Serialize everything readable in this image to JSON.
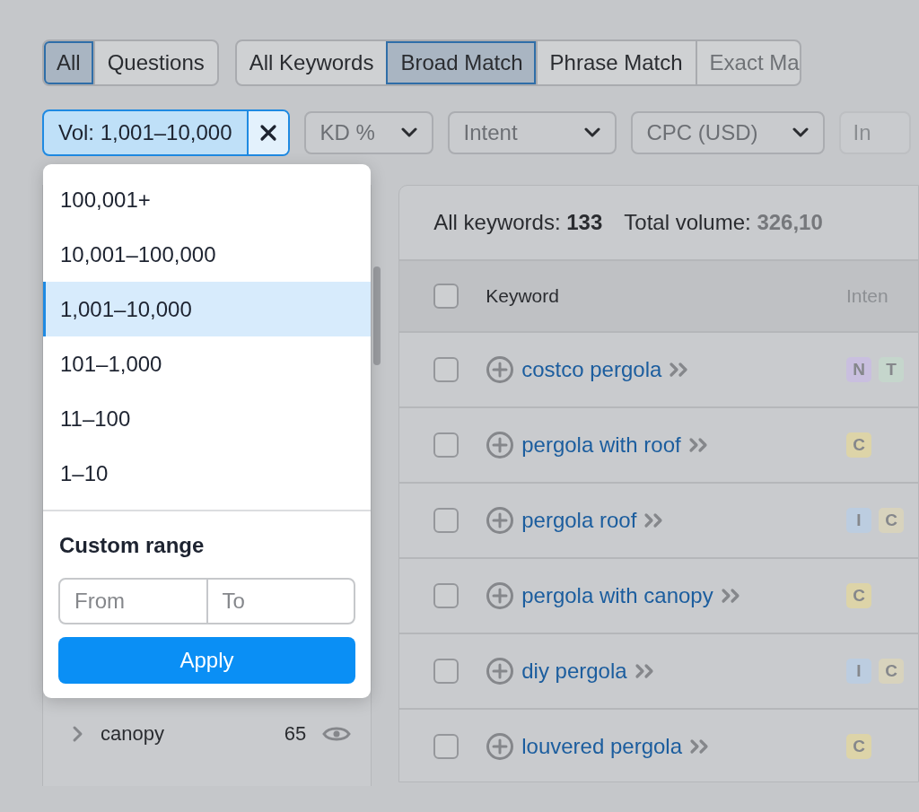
{
  "match_tabs": [
    {
      "label": "All",
      "selected": true
    },
    {
      "label": "Questions",
      "selected": false
    }
  ],
  "type_tabs": [
    {
      "label": "All Keywords",
      "selected": false
    },
    {
      "label": "Broad Match",
      "selected": true
    },
    {
      "label": "Phrase Match",
      "selected": false
    },
    {
      "label": "Exact Ma",
      "selected": false
    }
  ],
  "filters": [
    {
      "kind": "active",
      "label": "Vol: 1,001–10,000"
    },
    {
      "kind": "dropdown",
      "label": "KD %"
    },
    {
      "kind": "dropdown",
      "label": "Intent"
    },
    {
      "kind": "dropdown",
      "label": "CPC (USD)"
    },
    {
      "kind": "cut",
      "label": "In"
    }
  ],
  "volume_menu": {
    "options": [
      {
        "label": "100,001+",
        "selected": false
      },
      {
        "label": "10,001–100,000",
        "selected": false
      },
      {
        "label": "1,001–10,000",
        "selected": true
      },
      {
        "label": "101–1,000",
        "selected": false
      },
      {
        "label": "11–100",
        "selected": false
      },
      {
        "label": "1–10",
        "selected": false
      }
    ],
    "custom_range_title": "Custom range",
    "from_placeholder": "From",
    "to_placeholder": "To",
    "apply_button": "Apply"
  },
  "sidebar": {
    "items": [
      {
        "label": "canopy",
        "count": "65"
      }
    ]
  },
  "table": {
    "summary": [
      {
        "label": "All keywords:",
        "value": "133"
      },
      {
        "label": "Total volume:",
        "value": "326,10"
      }
    ],
    "columns": [
      "Keyword",
      "Inten"
    ],
    "header_checked": false,
    "rows": [
      {
        "checked": false,
        "keyword": "costco pergola",
        "intents": [
          {
            "letter": "N",
            "color": "#c9bfdf"
          },
          {
            "letter": "T",
            "color": "#c5d6cc"
          }
        ]
      },
      {
        "checked": false,
        "keyword": "pergola with roof",
        "intents": [
          {
            "letter": "C",
            "color": "#ddd4a8"
          }
        ]
      },
      {
        "checked": false,
        "keyword": "pergola roof",
        "intents": [
          {
            "letter": "I",
            "color": "#bccde0"
          },
          {
            "letter": "C",
            "color": "#d8d3bd"
          }
        ]
      },
      {
        "checked": false,
        "keyword": "pergola with canopy",
        "intents": [
          {
            "letter": "C",
            "color": "#ddd4a8"
          }
        ]
      },
      {
        "checked": false,
        "keyword": "diy pergola",
        "intents": [
          {
            "letter": "I",
            "color": "#bccde0"
          },
          {
            "letter": "C",
            "color": "#d8d3bd"
          }
        ]
      },
      {
        "checked": false,
        "keyword": "louvered pergola",
        "intents": [
          {
            "letter": "C",
            "color": "#ddd4a8"
          }
        ]
      }
    ]
  }
}
